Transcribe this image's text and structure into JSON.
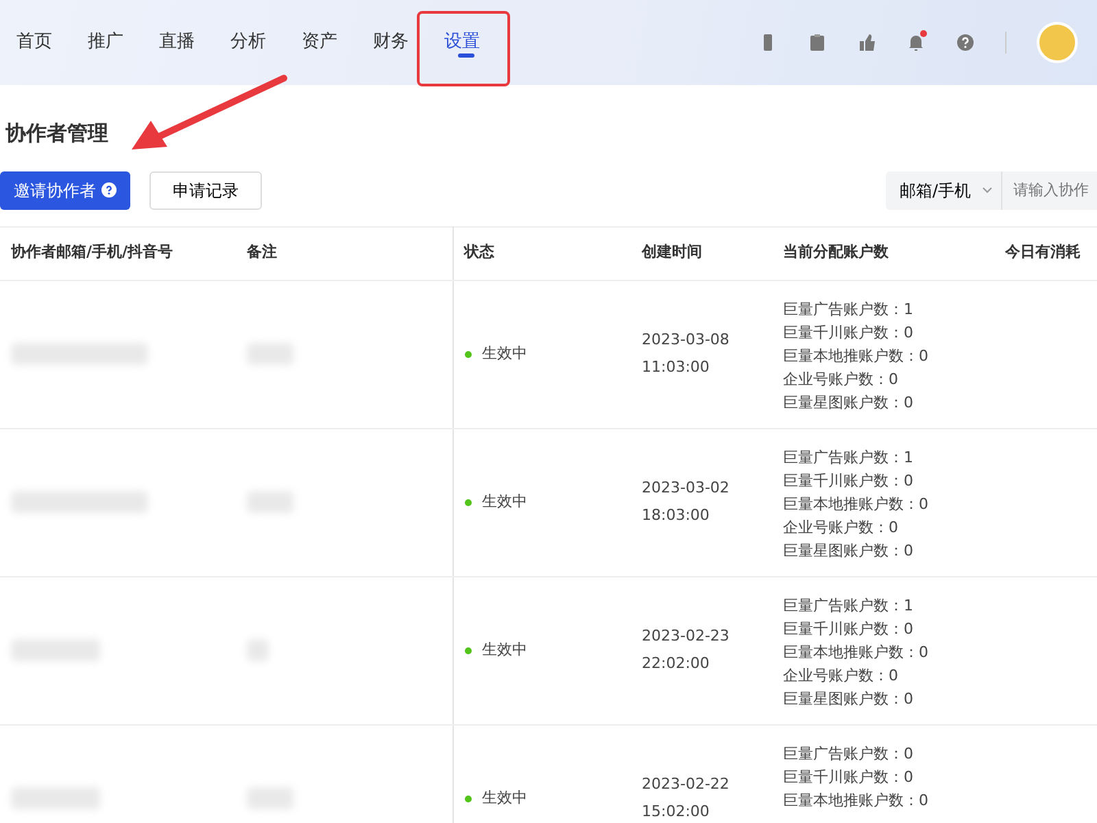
{
  "nav": {
    "tabs": [
      {
        "label": "首页",
        "selected": false
      },
      {
        "label": "推广",
        "selected": false
      },
      {
        "label": "直播",
        "selected": false
      },
      {
        "label": "分析",
        "selected": false
      },
      {
        "label": "资产",
        "selected": false
      },
      {
        "label": "财务",
        "selected": false
      },
      {
        "label": "设置",
        "selected": true
      }
    ],
    "notification_dot": true
  },
  "page": {
    "title": "协作者管理",
    "invite_button": "邀请协作者",
    "records_button": "申请记录",
    "search_type": "邮箱/手机",
    "search_placeholder": "请输入协作"
  },
  "table": {
    "columns": [
      "协作者邮箱/手机/抖音号",
      "备注",
      "状态",
      "创建时间",
      "当前分配账户数",
      "今日有消耗"
    ],
    "rows": [
      {
        "status": "生效中",
        "color": "#52c41a",
        "created": [
          "2023-03-08",
          "11:03:00"
        ],
        "accounts": [
          "巨量广告账户数：1",
          "巨量千川账户数：0",
          "巨量本地推账户数：0",
          "企业号账户数：0",
          "巨量星图账户数：0"
        ]
      },
      {
        "status": "生效中",
        "color": "#52c41a",
        "created": [
          "2023-03-02",
          "18:03:00"
        ],
        "accounts": [
          "巨量广告账户数：1",
          "巨量千川账户数：0",
          "巨量本地推账户数：0",
          "企业号账户数：0",
          "巨量星图账户数：0"
        ]
      },
      {
        "status": "生效中",
        "color": "#52c41a",
        "created": [
          "2023-02-23",
          "22:02:00"
        ],
        "accounts": [
          "巨量广告账户数：1",
          "巨量千川账户数：0",
          "巨量本地推账户数：0",
          "企业号账户数：0",
          "巨量星图账户数：0"
        ]
      },
      {
        "status": "生效中",
        "color": "#52c41a",
        "created": [
          "2023-02-22",
          "15:02:00"
        ],
        "accounts": [
          "巨量广告账户数：0",
          "巨量千川账户数：0",
          "巨量本地推账户数：0"
        ]
      }
    ]
  }
}
